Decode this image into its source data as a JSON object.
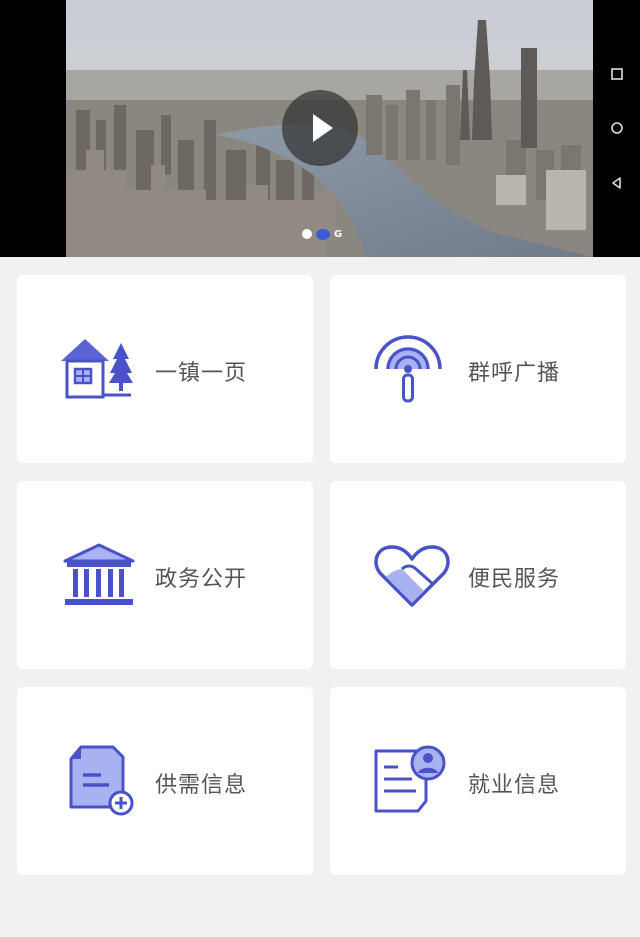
{
  "banner": {
    "play_icon": "play-icon",
    "carousel_indicator_text": "G",
    "carousel": {
      "count": 2,
      "active_index": 1
    }
  },
  "system_nav": {
    "buttons": [
      "recent-apps-icon",
      "home-icon",
      "back-icon"
    ]
  },
  "colors": {
    "accent": "#4a52c9",
    "accent_light": "#a8b2f0",
    "card_bg": "#ffffff",
    "page_bg": "#f1f1f1",
    "label_text": "#555555"
  },
  "tiles": [
    {
      "label": "一镇一页",
      "icon": "house-tree-icon"
    },
    {
      "label": "群呼广播",
      "icon": "broadcast-icon"
    },
    {
      "label": "政务公开",
      "icon": "government-building-icon"
    },
    {
      "label": "便民服务",
      "icon": "heart-icon"
    },
    {
      "label": "供需信息",
      "icon": "document-add-icon"
    },
    {
      "label": "就业信息",
      "icon": "resume-user-icon"
    }
  ]
}
